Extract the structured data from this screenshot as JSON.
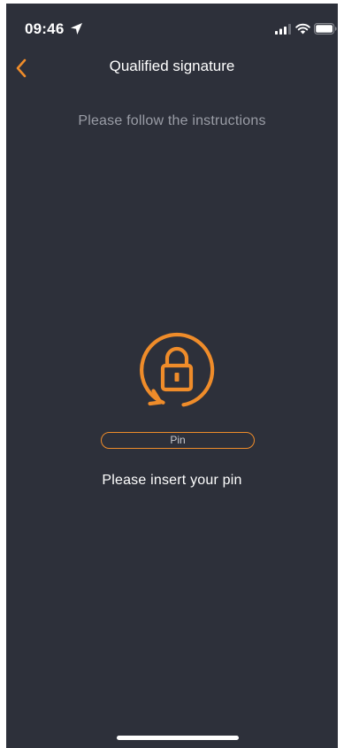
{
  "status_bar": {
    "time": "09:46"
  },
  "nav": {
    "title": "Qualified signature"
  },
  "instructions": "Please follow the instructions",
  "pin_field": {
    "placeholder": "Pin",
    "value": ""
  },
  "prompt": "Please insert your pin",
  "colors": {
    "background": "#2d303a",
    "accent": "#ef8c2a",
    "text_primary": "#ffffff",
    "text_secondary": "#9a9da6"
  },
  "icons": {
    "back": "chevron-left-icon",
    "lock": "lock-refresh-icon",
    "location": "location-arrow-icon",
    "signal": "cellular-signal-icon",
    "wifi": "wifi-icon",
    "battery": "battery-icon"
  }
}
